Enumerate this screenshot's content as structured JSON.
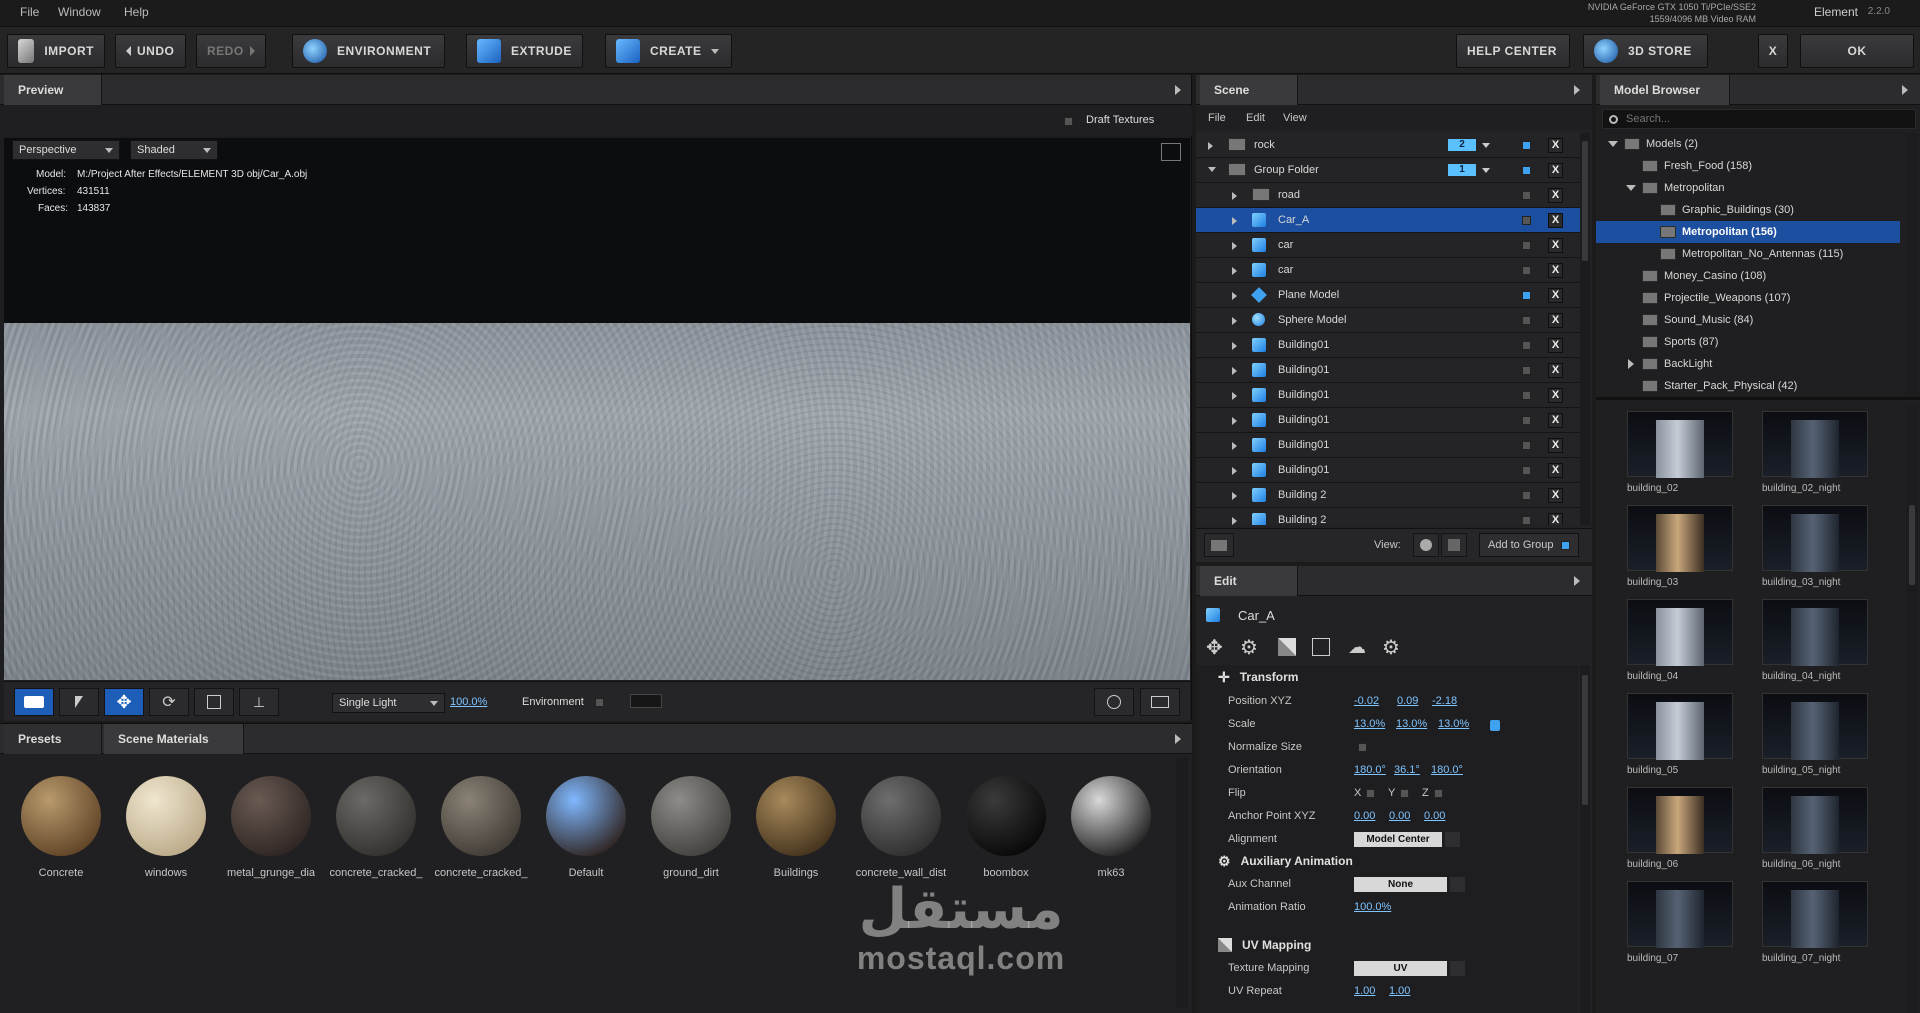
{
  "menu": {
    "items": [
      "File",
      "Window",
      "Help"
    ]
  },
  "gpu_info": {
    "line1": "NVIDIA GeForce GTX 1050 Ti/PCIe/SSE2",
    "line2": "1559/4096 MB Video RAM"
  },
  "app": {
    "name": "Element",
    "version": "2.2.0"
  },
  "toolbar": {
    "import": "IMPORT",
    "undo": "UNDO",
    "redo": "REDO",
    "environment": "ENVIRONMENT",
    "extrude": "EXTRUDE",
    "create": "CREATE",
    "help_center": "HELP CENTER",
    "store": "3D STORE",
    "close": "X",
    "ok": "OK"
  },
  "preview": {
    "tab": "Preview",
    "draft_textures": "Draft Textures",
    "camera_mode": "Perspective",
    "shading_mode": "Shaded",
    "model_label": "Model:",
    "model_path": "M:/Project After Effects/ELEMENT 3D obj/Car_A.obj",
    "vertices_label": "Vertices:",
    "vertices": "431511",
    "faces_label": "Faces:",
    "faces": "143837",
    "light_mode": "Single Light",
    "light_percent": "100.0%",
    "environment_label": "Environment"
  },
  "presets": {
    "tab_presets": "Presets",
    "tab_materials": "Scene Materials",
    "materials": [
      {
        "name": "Concrete",
        "color_a": "#b89a6c",
        "color_b": "#5a3e22"
      },
      {
        "name": "windows",
        "color_a": "#f0e6cf",
        "color_b": "#b7a684"
      },
      {
        "name": "metal_grunge_dia",
        "color_a": "#6a5a52",
        "color_b": "#2a2220"
      },
      {
        "name": "concrete_cracked_",
        "color_a": "#6c6a66",
        "color_b": "#2e2d2b"
      },
      {
        "name": "concrete_cracked_",
        "color_a": "#8a8276",
        "color_b": "#3b3630"
      },
      {
        "name": "Default",
        "color_a": "#7fb8ff",
        "color_b": "#2a1a12"
      },
      {
        "name": "ground_dirt",
        "color_a": "#8e8c88",
        "color_b": "#3c3b38"
      },
      {
        "name": "Buildings",
        "color_a": "#a88b5c",
        "color_b": "#3d2c18"
      },
      {
        "name": "concrete_wall_dist",
        "color_a": "#6e6e6e",
        "color_b": "#2a2a2a"
      },
      {
        "name": "boombox",
        "color_a": "#3a3a3a",
        "color_b": "#050505"
      },
      {
        "name": "mk63",
        "color_a": "#d8d8d8",
        "color_b": "#151515"
      }
    ]
  },
  "scene": {
    "tab": "Scene",
    "menu": [
      "File",
      "Edit",
      "View"
    ],
    "rows": [
      {
        "name": "rock",
        "type": "folder",
        "expanded": false,
        "indent": 0,
        "badge": "2",
        "visible": true,
        "selected": false
      },
      {
        "name": "Group Folder",
        "type": "folder",
        "expanded": true,
        "indent": 0,
        "badge": "1",
        "visible": true,
        "selected": false
      },
      {
        "name": "road",
        "type": "folder",
        "expanded": false,
        "indent": 1,
        "badge": "",
        "visible": false,
        "selected": false
      },
      {
        "name": "Car_A",
        "type": "cube",
        "expanded": false,
        "indent": 1,
        "badge": "",
        "visible": false,
        "selected": true
      },
      {
        "name": "car",
        "type": "cube",
        "expanded": false,
        "indent": 1,
        "badge": "",
        "visible": false,
        "selected": false
      },
      {
        "name": "car",
        "type": "cube",
        "expanded": false,
        "indent": 1,
        "badge": "",
        "visible": false,
        "selected": false
      },
      {
        "name": "Plane Model",
        "type": "plane",
        "expanded": false,
        "indent": 1,
        "badge": "",
        "visible": true,
        "selected": false
      },
      {
        "name": "Sphere Model",
        "type": "sphere",
        "expanded": false,
        "indent": 1,
        "badge": "",
        "visible": false,
        "selected": false
      },
      {
        "name": "Building01",
        "type": "cube",
        "expanded": false,
        "indent": 1,
        "badge": "",
        "visible": false,
        "selected": false
      },
      {
        "name": "Building01",
        "type": "cube",
        "expanded": false,
        "indent": 1,
        "badge": "",
        "visible": false,
        "selected": false
      },
      {
        "name": "Building01",
        "type": "cube",
        "expanded": false,
        "indent": 1,
        "badge": "",
        "visible": false,
        "selected": false
      },
      {
        "name": "Building01",
        "type": "cube",
        "expanded": false,
        "indent": 1,
        "badge": "",
        "visible": false,
        "selected": false
      },
      {
        "name": "Building01",
        "type": "cube",
        "expanded": false,
        "indent": 1,
        "badge": "",
        "visible": false,
        "selected": false
      },
      {
        "name": "Building01",
        "type": "cube",
        "expanded": false,
        "indent": 1,
        "badge": "",
        "visible": false,
        "selected": false
      },
      {
        "name": "Building 2",
        "type": "cube",
        "expanded": false,
        "indent": 1,
        "badge": "",
        "visible": false,
        "selected": false
      },
      {
        "name": "Building 2",
        "type": "cube",
        "expanded": false,
        "indent": 1,
        "badge": "",
        "visible": false,
        "selected": false
      }
    ],
    "view_label": "View:",
    "add_to_group": "Add to Group"
  },
  "edit": {
    "tab": "Edit",
    "object_name": "Car_A",
    "transform": {
      "title": "Transform",
      "position_label": "Position XYZ",
      "position": [
        "-0.02",
        "0.09",
        "-2.18"
      ],
      "scale_label": "Scale",
      "scale": [
        "13.0%",
        "13.0%",
        "13.0%"
      ],
      "normalize_label": "Normalize Size",
      "orientation_label": "Orientation",
      "orientation": [
        "180.0°",
        "36.1°",
        "180.0°"
      ],
      "flip_label": "Flip",
      "flip_axes": [
        "X",
        "Y",
        "Z"
      ],
      "anchor_label": "Anchor Point XYZ",
      "anchor": [
        "0.00",
        "0.00",
        "0.00"
      ],
      "alignment_label": "Alignment",
      "alignment": "Model Center"
    },
    "aux": {
      "title": "Auxiliary Animation",
      "channel_label": "Aux Channel",
      "channel": "None",
      "ratio_label": "Animation Ratio",
      "ratio": "100.0%"
    },
    "uv": {
      "title": "UV Mapping",
      "mapping_label": "Texture Mapping",
      "mapping": "UV",
      "repeat_label": "UV Repeat",
      "repeat": [
        "1.00",
        "1.00"
      ]
    }
  },
  "model_browser": {
    "tab": "Model Browser",
    "search_placeholder": "Search...",
    "tree": [
      {
        "label": "Models (2)",
        "indent": 0,
        "expand": "down",
        "selected": false
      },
      {
        "label": "Fresh_Food (158)",
        "indent": 1,
        "expand": "",
        "selected": false
      },
      {
        "label": "Metropolitan",
        "indent": 1,
        "expand": "down",
        "selected": false
      },
      {
        "label": "Graphic_Buildings (30)",
        "indent": 2,
        "expand": "",
        "selected": false
      },
      {
        "label": "Metropolitan (156)",
        "indent": 2,
        "expand": "",
        "selected": true
      },
      {
        "label": "Metropolitan_No_Antennas (115)",
        "indent": 2,
        "expand": "",
        "selected": false
      },
      {
        "label": "Money_Casino (108)",
        "indent": 1,
        "expand": "",
        "selected": false
      },
      {
        "label": "Projectile_Weapons (107)",
        "indent": 1,
        "expand": "",
        "selected": false
      },
      {
        "label": "Sound_Music (84)",
        "indent": 1,
        "expand": "",
        "selected": false
      },
      {
        "label": "Sports (87)",
        "indent": 1,
        "expand": "",
        "selected": false
      },
      {
        "label": "BackLight",
        "indent": 1,
        "expand": "right",
        "selected": false
      },
      {
        "label": "Starter_Pack_Physical (42)",
        "indent": 1,
        "expand": "",
        "selected": false
      }
    ],
    "thumbnails": [
      {
        "label": "building_02",
        "style": "day"
      },
      {
        "label": "building_02_night",
        "style": "night"
      },
      {
        "label": "building_03",
        "style": "warm"
      },
      {
        "label": "building_03_night",
        "style": "night"
      },
      {
        "label": "building_04",
        "style": "day"
      },
      {
        "label": "building_04_night",
        "style": "night"
      },
      {
        "label": "building_05",
        "style": "day"
      },
      {
        "label": "building_05_night",
        "style": "night"
      },
      {
        "label": "building_06",
        "style": "warm"
      },
      {
        "label": "building_06_night",
        "style": "night"
      },
      {
        "label": "building_07",
        "style": "night"
      },
      {
        "label": "building_07_night",
        "style": "night"
      }
    ]
  },
  "watermark": {
    "arabic": "مستقل",
    "latin": "mostaql.com"
  },
  "colors": {
    "accent": "#1d4fa1",
    "link": "#7fc4ff",
    "check_on": "#3fa2f0"
  }
}
